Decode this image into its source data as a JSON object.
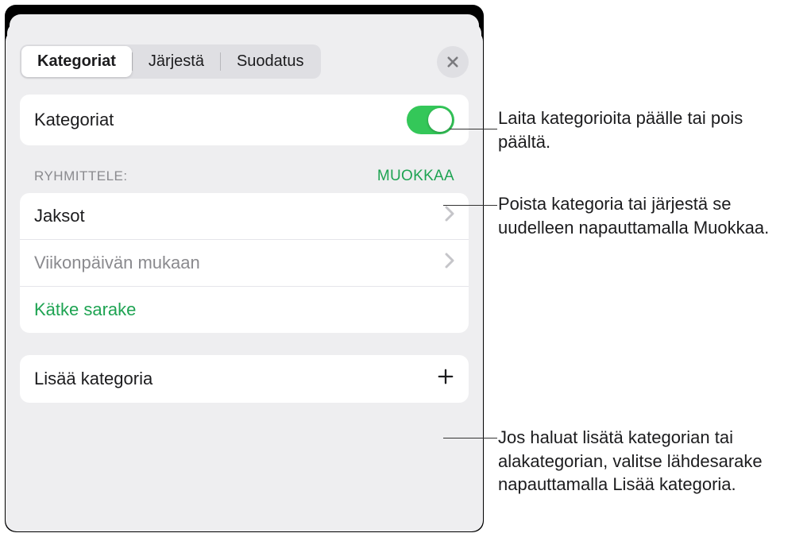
{
  "tabs": {
    "categories": "Kategoriat",
    "sort": "Järjestä",
    "filter": "Suodatus"
  },
  "toggle": {
    "label": "Kategoriat"
  },
  "group_section": {
    "header": "RYHMITTELE:",
    "edit": "MUOKKAA",
    "rows": [
      {
        "primary": "Jaksot"
      },
      {
        "primary": "Viikonpäivän",
        "secondary": " mukaan"
      }
    ],
    "hide_column": "Kätke sarake"
  },
  "add_category": {
    "label": "Lisää kategoria"
  },
  "callouts": {
    "toggle": "Laita kategorioita päälle tai pois päältä.",
    "edit": "Poista kategoria tai järjestä se uudelleen napauttamalla Muokkaa.",
    "add": "Jos haluat lisätä kategorian tai alakategorian, valitse lähdesarake napauttamalla Lisää kategoria."
  }
}
